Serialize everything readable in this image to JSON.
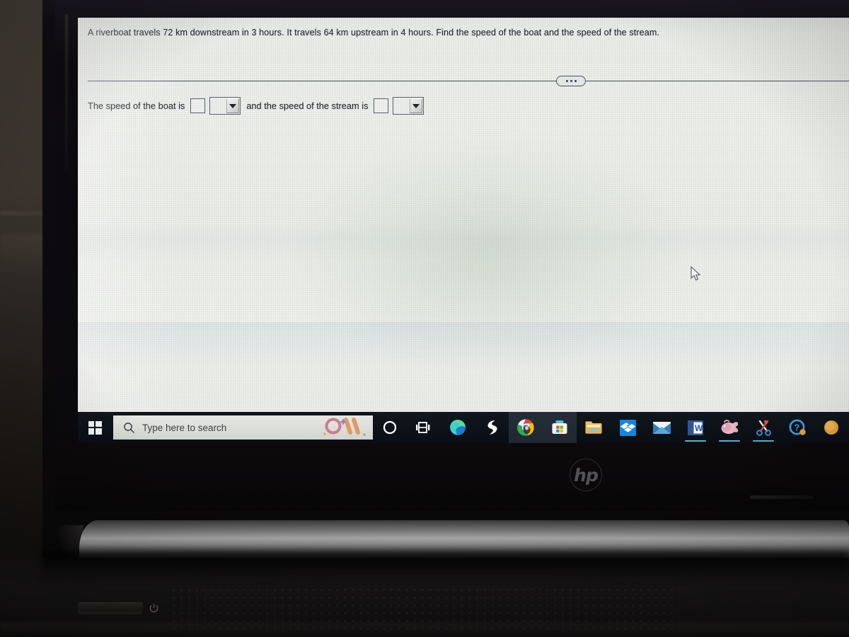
{
  "problem": {
    "question": "A riverboat travels 72 km downstream in 3 hours. It travels 64 km upstream in 4 hours. Find the speed of the boat and the speed of the stream.",
    "more_button": "...",
    "answer_prefix": "The speed of the boat is",
    "answer_middle": "and the speed of the stream is",
    "boat_value": "",
    "boat_unit_selected": "",
    "stream_value": "",
    "stream_unit_selected": ""
  },
  "taskbar": {
    "start_label": "Start",
    "search_placeholder": "Type here to search",
    "items": [
      {
        "name": "cortana",
        "label": "Cortana",
        "active": false,
        "color": "#ffffff"
      },
      {
        "name": "task-view",
        "label": "Task View",
        "active": false,
        "color": "#ffffff"
      },
      {
        "name": "microsoft-edge",
        "label": "Microsoft Edge",
        "active": false,
        "color": "#2d8ae0"
      },
      {
        "name": "flash-app",
        "label": "Flash",
        "active": false,
        "color": "#ffffff"
      },
      {
        "name": "google-chrome",
        "label": "Google Chrome",
        "active": true,
        "color": "#4285f4"
      },
      {
        "name": "microsoft-store",
        "label": "Microsoft Store",
        "active": true,
        "color": "#f3f5f7"
      },
      {
        "name": "file-explorer",
        "label": "File Explorer",
        "active": false,
        "color": "#f2b33d"
      },
      {
        "name": "dropbox",
        "label": "Dropbox",
        "active": false,
        "color": "#0d7ee0"
      },
      {
        "name": "mail",
        "label": "Mail",
        "active": false,
        "color": "#5ba7d6"
      },
      {
        "name": "microsoft-word",
        "label": "Word",
        "active": true,
        "color": "#2b579a"
      },
      {
        "name": "paint",
        "label": "Paint",
        "active": true,
        "color": "#d88fa0"
      },
      {
        "name": "snipping-tool",
        "label": "Snipping Tool",
        "active": true,
        "color": "#e05a3c"
      },
      {
        "name": "get-help",
        "label": "Get Help",
        "active": false,
        "color": "#3ba7e0"
      },
      {
        "name": "orange-app",
        "label": "Orange App",
        "active": false,
        "color": "#e8a336"
      }
    ]
  },
  "device": {
    "brand": "hp",
    "power_label": "Power"
  },
  "colors": {
    "taskbar_bg": "#0d1219",
    "screen_bg": "#eceeea",
    "text": "#23252f",
    "field_border": "#5b6173",
    "divider": "#4b5266",
    "active_underline": "#57b5c4"
  }
}
